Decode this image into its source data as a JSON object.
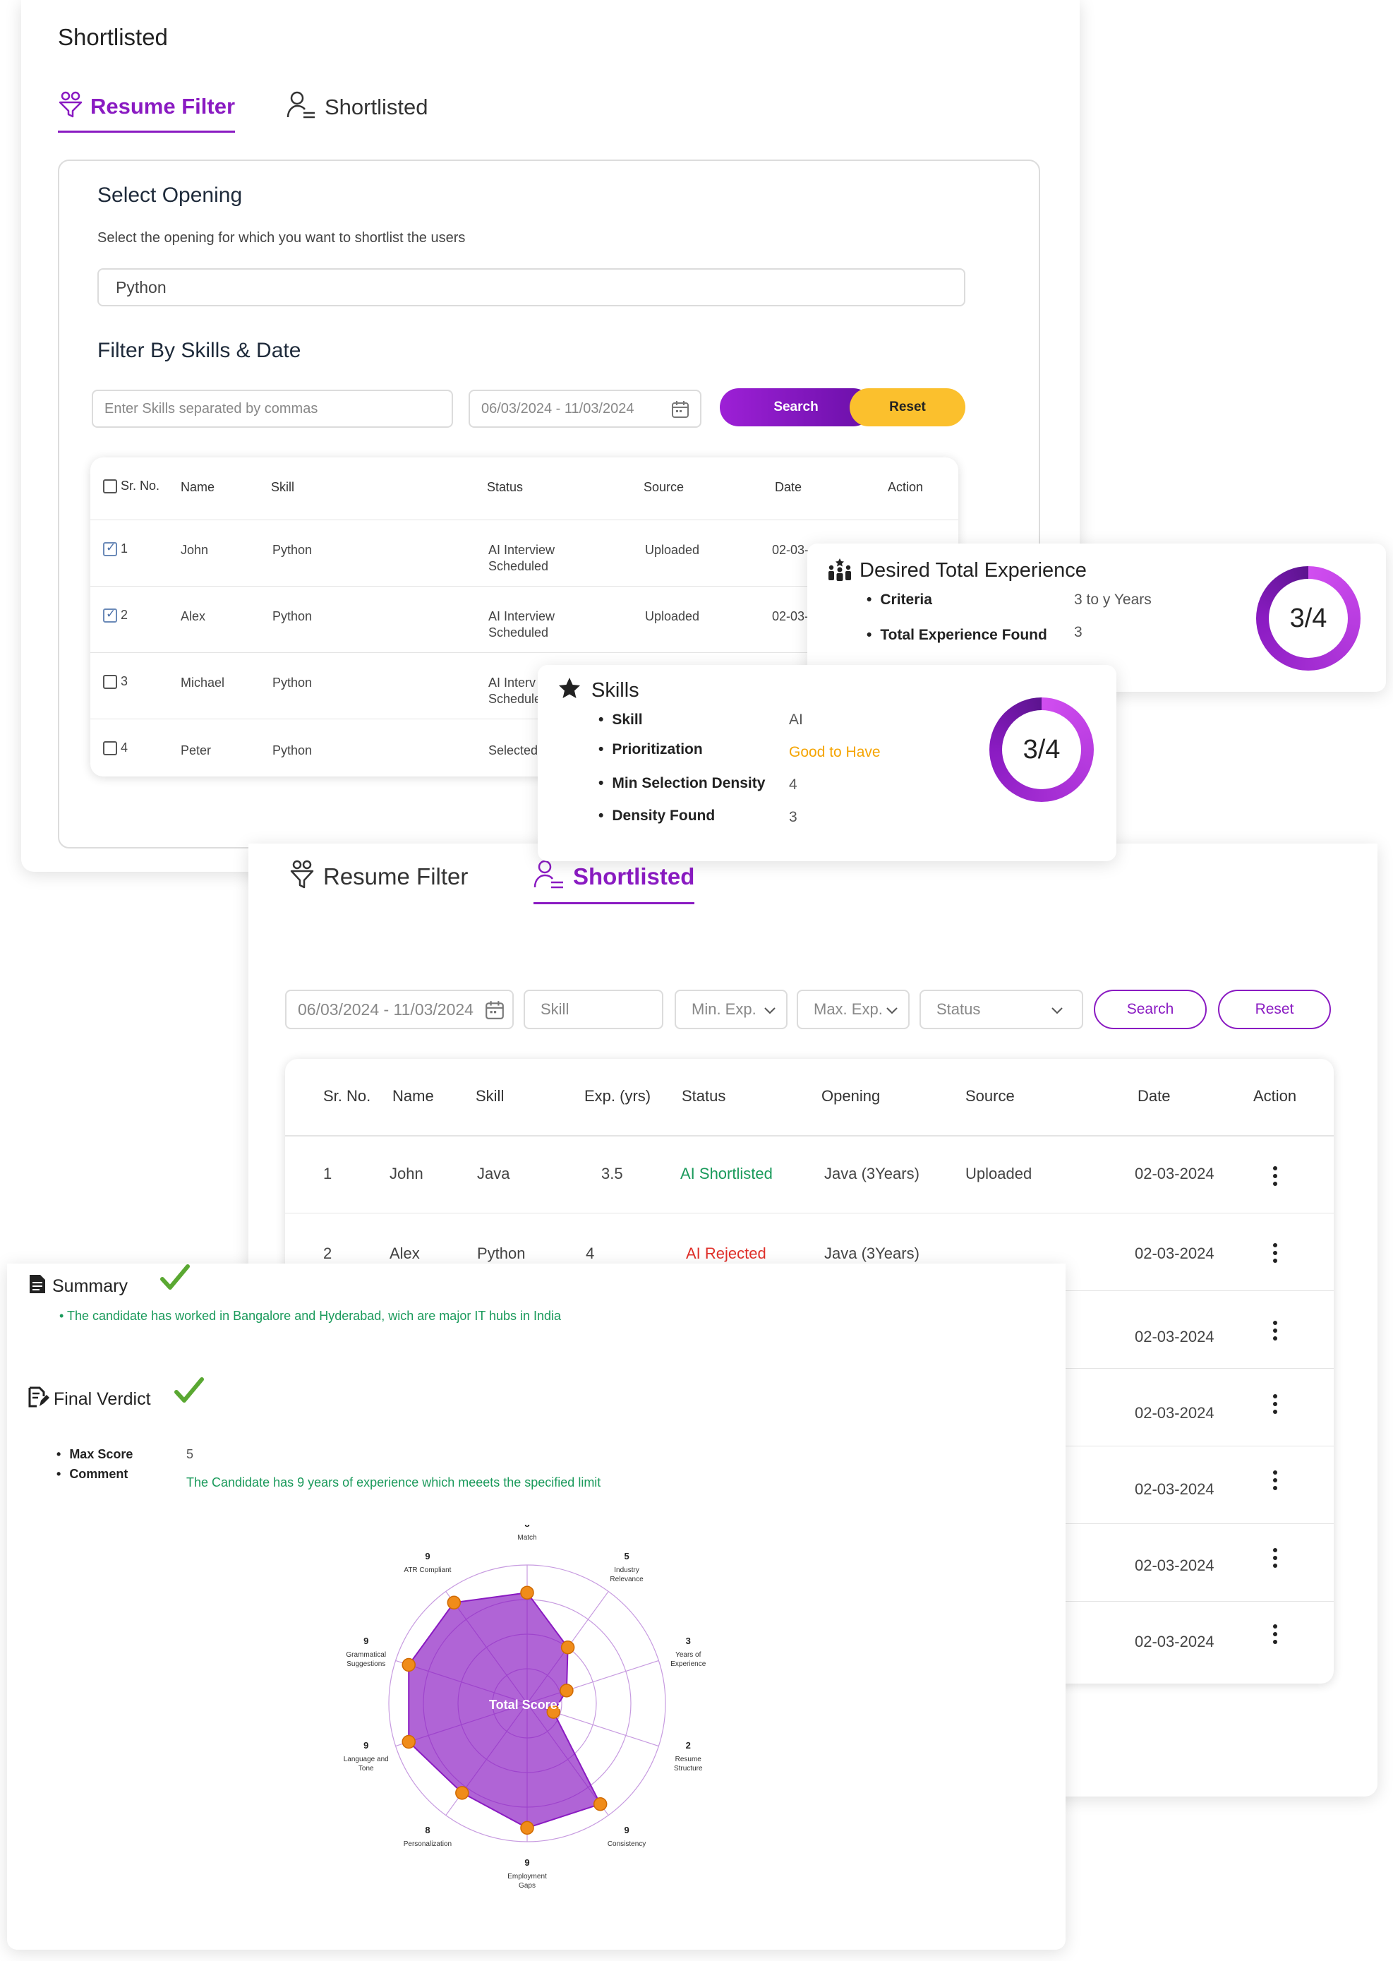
{
  "panel1": {
    "title": "Shortlisted",
    "tabs": [
      "Resume Filter",
      "Shortlisted"
    ],
    "select_heading": "Select Opening",
    "select_desc": "Select the opening for which you want to shortlist the users",
    "select_value": "Python",
    "filter_heading": "Filter By Skills & Date",
    "skills_placeholder": "Enter Skills separated by commas",
    "date_range": "06/03/2024 - 11/03/2024",
    "search_label": "Search",
    "reset_label": "Reset",
    "columns": [
      "Sr. No.",
      "Name",
      "Skill",
      "Status",
      "Source",
      "Date",
      "Action"
    ],
    "rows": [
      {
        "no": "1",
        "name": "John",
        "skill": "Python",
        "status1": "AI Interview",
        "status2": "Scheduled",
        "source": "Uploaded",
        "date": "02-03-"
      },
      {
        "no": "2",
        "name": "Alex",
        "skill": "Python",
        "status1": "AI Interview",
        "status2": "Scheduled",
        "source": "Uploaded",
        "date": "02-03-"
      },
      {
        "no": "3",
        "name": "Michael",
        "skill": "Python",
        "status1": "AI Interv",
        "status2": "Schedule",
        "source": "",
        "date": ""
      },
      {
        "no": "4",
        "name": "Peter",
        "skill": "Python",
        "status1": "Selected",
        "status2": "",
        "source": "",
        "date": ""
      }
    ]
  },
  "experience_card": {
    "title": "Desired Total Experience",
    "criteria_label": "Criteria",
    "criteria_value": "3 to y Years",
    "found_label": "Total Experience Found",
    "found_value": "3",
    "score": "3/4",
    "score_fraction": 0.75
  },
  "skills_card": {
    "title": "Skills",
    "skill_label": "Skill",
    "skill_value": "AI",
    "prio_label": "Prioritization",
    "prio_value": "Good to Have",
    "min_label": "Min Selection Density",
    "min_value": "4",
    "found_label": "Density Found",
    "found_value": "3",
    "score": "3/4",
    "score_fraction": 0.75
  },
  "panel2": {
    "tabs": [
      "Resume Filter",
      "Shortlisted"
    ],
    "date_range": "06/03/2024 - 11/03/2024",
    "skill_placeholder": "Skill",
    "min_exp": "Min. Exp.",
    "max_exp": "Max. Exp.",
    "status": "Status",
    "search_label": "Search",
    "reset_label": "Reset",
    "columns": [
      "Sr. No.",
      "Name",
      "Skill",
      "Exp. (yrs)",
      "Status",
      "Opening",
      "Source",
      "Date",
      "Action"
    ],
    "rows": [
      {
        "no": "1",
        "name": "John",
        "skill": "Java",
        "exp": "3.5",
        "status": "AI Shortlisted",
        "opening": "Java (3Years)",
        "source": "Uploaded",
        "date": "02-03-2024"
      },
      {
        "no": "2",
        "name": "Alex",
        "skill": "Python",
        "exp": "4",
        "status": "AI Rejected",
        "opening": "Java (3Years)",
        "source": "",
        "date": "02-03-2024"
      },
      {
        "date": "02-03-2024"
      },
      {
        "date": "02-03-2024"
      },
      {
        "date": "02-03-2024"
      },
      {
        "date": "02-03-2024"
      },
      {
        "date": "02-03-2024"
      }
    ]
  },
  "panel3": {
    "summary_title": "Summary",
    "summary_text": "The candidate has worked in Bangalore and Hyderabad, wich are major IT hubs in India",
    "verdict_title": "Final Verdict",
    "max_score_label": "Max Score",
    "max_score_value": "5",
    "comment_label": "Comment",
    "comment_text": "The Candidate has 9 years of experience which meeets the specified limit"
  },
  "chart_data": {
    "type": "radar",
    "center_label": "Total Score: 9",
    "max": 10,
    "axes": [
      {
        "label": "Match",
        "value": 8
      },
      {
        "label": "Industry Relevance",
        "value": 5
      },
      {
        "label": "Years of Experience",
        "value": 3
      },
      {
        "label": "Resume Structure",
        "value": 2
      },
      {
        "label": "Consistency",
        "value": 9
      },
      {
        "label": "Employment Gaps",
        "value": 9
      },
      {
        "label": "Personalization",
        "value": 8
      },
      {
        "label": "Language and Tone",
        "value": 9
      },
      {
        "label": "Grammatical Suggestions",
        "value": 9
      },
      {
        "label": "ATR Compliant",
        "value": 9
      }
    ]
  },
  "colors": {
    "accent": "#8a1bc2",
    "warning": "#f5b800",
    "success": "#1a9a5b",
    "danger": "#e0302a",
    "check": "#5aa832"
  }
}
